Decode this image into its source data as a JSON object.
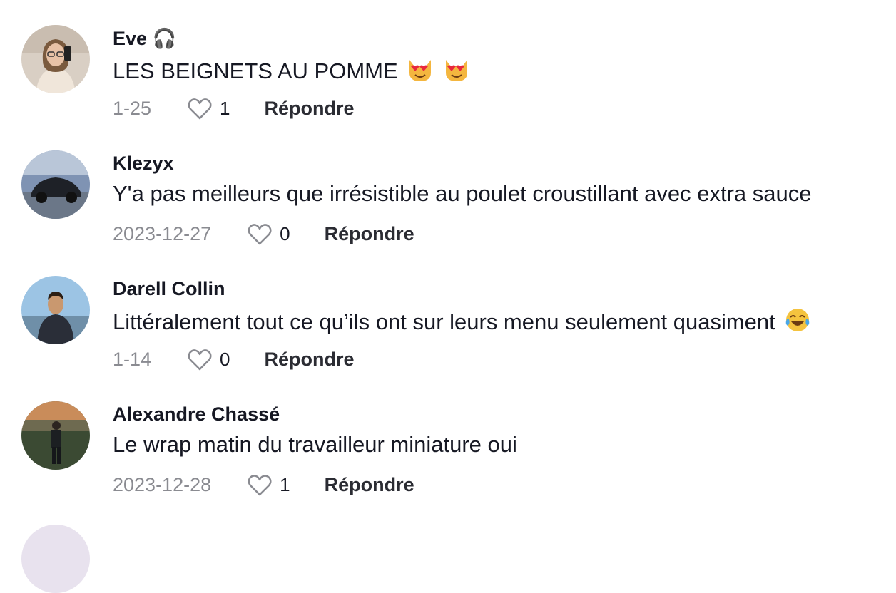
{
  "colors": {
    "text": "#161823",
    "meta": "#8a8b91",
    "reply": "#2b2c33"
  },
  "comments": [
    {
      "username": "Eve 🎧",
      "username_icon": "headphones-icon",
      "text": "LES BEIGNETS AU POMME",
      "emojis": [
        "heart-eyes-cat-emoji",
        "heart-eyes-cat-emoji"
      ],
      "date": "1-25",
      "likes": "1",
      "reply_label": "Répondre"
    },
    {
      "username": "Klezyx",
      "text": "Y'a pas meilleurs que irrésistible au poulet croustillant avec extra sauce",
      "date": "2023-12-27",
      "likes": "0",
      "reply_label": "Répondre"
    },
    {
      "username": "Darell Collin",
      "text": "Littéralement tout ce qu’ils ont sur leurs menu seulement quasiment",
      "emojis": [
        "tears-of-joy-emoji"
      ],
      "date": "1-14",
      "likes": "0",
      "reply_label": "Répondre"
    },
    {
      "username": "Alexandre Chassé",
      "text": "Le wrap matin du travailleur miniature oui",
      "date": "2023-12-28",
      "likes": "1",
      "reply_label": "Répondre"
    }
  ]
}
